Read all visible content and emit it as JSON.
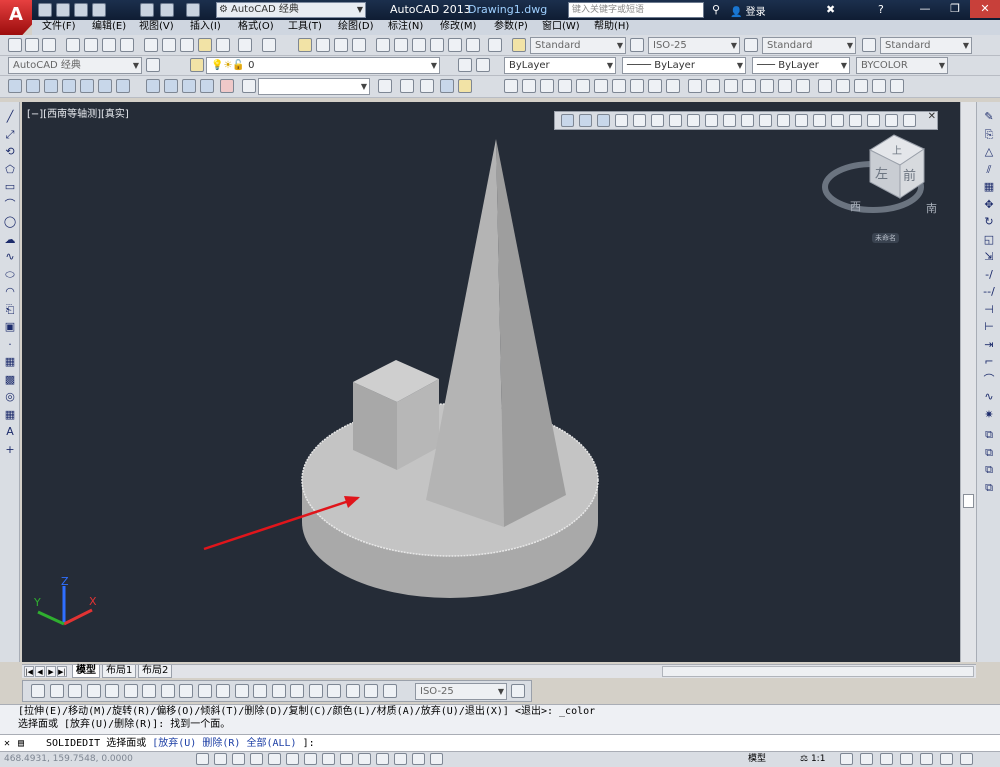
{
  "app": {
    "logo_letter": "A",
    "workspace": "AutoCAD 经典",
    "app_name": "AutoCAD 2013",
    "document": "Drawing1.dwg",
    "search_placeholder": "键入关键字或短语",
    "login": "登录"
  },
  "menu": [
    "文件(F)",
    "编辑(E)",
    "视图(V)",
    "插入(I)",
    "格式(O)",
    "工具(T)",
    "绘图(D)",
    "标注(N)",
    "修改(M)",
    "参数(P)",
    "窗口(W)",
    "帮助(H)"
  ],
  "styles": {
    "text_style": "Standard",
    "dim_style": "ISO-25",
    "table_style": "Standard",
    "mleader_style": "Standard"
  },
  "layers": {
    "workspace": "AutoCAD 经典",
    "current_layer": "0",
    "color": "ByLayer",
    "linetype": "ByLayer",
    "lineweight": "ByLayer",
    "plotstyle": "BYCOLOR"
  },
  "viewport": {
    "label": "[−][西南等轴测][真实]",
    "viewcube_top": "上",
    "viewcube_left": "左",
    "viewcube_front": "前",
    "compass_west": "西",
    "compass_south": "南",
    "ucs_name": "未命名",
    "colors": {
      "background": "#252c37",
      "arrow": "#e0151b",
      "solid": "#bdbdbd"
    }
  },
  "axes": {
    "x": "X",
    "y": "Y",
    "z": "Z"
  },
  "tabs": [
    "模型",
    "布局1",
    "布局2"
  ],
  "dim_toolbar": {
    "style": "ISO-25"
  },
  "command": {
    "history_1": "[拉伸(E)/移动(M)/旋转(R)/偏移(O)/倾斜(T)/删除(D)/复制(C)/颜色(L)/材质(A)/放弃(U)/退出(X)] <退出>: _color",
    "history_2": "选择面或 [放弃(U)/删除(R)]: 找到一个面。",
    "prompt_cmd": "SOLIDEDIT 选择面或",
    "opt_1": "[放弃(U)",
    "opt_2": "删除(R)",
    "opt_3": "全部(ALL)",
    "opt_end": "]:"
  },
  "status": {
    "coordinates": "468.4931, 159.7548, 0.0000",
    "space": "模型",
    "scale": "1:1"
  }
}
